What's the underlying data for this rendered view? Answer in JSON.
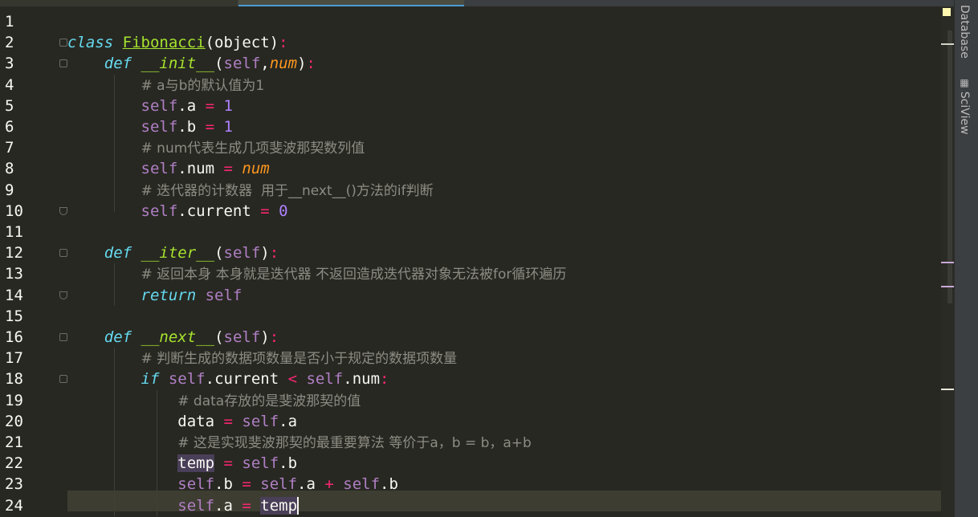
{
  "editor": {
    "line_numbers": [
      "1",
      "2",
      "3",
      "4",
      "5",
      "6",
      "7",
      "8",
      "9",
      "10",
      "11",
      "12",
      "13",
      "14",
      "15",
      "16",
      "17",
      "18",
      "19",
      "20",
      "21",
      "22",
      "23",
      "24"
    ],
    "lines": [
      [],
      [
        [
          "kw",
          "class"
        ],
        [
          "plain",
          " "
        ],
        [
          "cls",
          "Fibonacci"
        ],
        [
          "plain",
          "(object)"
        ],
        [
          "op",
          ":"
        ]
      ],
      [
        [
          "plain",
          "    "
        ],
        [
          "kw",
          "def"
        ],
        [
          "plain",
          " "
        ],
        [
          "fn",
          "__init__"
        ],
        [
          "plain",
          "("
        ],
        [
          "self",
          "self"
        ],
        [
          "plain",
          ","
        ],
        [
          "param",
          "num"
        ],
        [
          "plain",
          ")"
        ],
        [
          "op",
          ":"
        ]
      ],
      [
        [
          "plain",
          "        "
        ],
        [
          "cm",
          "# a与b的默认值为1"
        ]
      ],
      [
        [
          "plain",
          "        "
        ],
        [
          "self",
          "self"
        ],
        [
          "plain",
          ".a "
        ],
        [
          "op",
          "="
        ],
        [
          "plain",
          " "
        ],
        [
          "num",
          "1"
        ]
      ],
      [
        [
          "plain",
          "        "
        ],
        [
          "self",
          "self"
        ],
        [
          "plain",
          ".b "
        ],
        [
          "op",
          "="
        ],
        [
          "plain",
          " "
        ],
        [
          "num",
          "1"
        ]
      ],
      [
        [
          "plain",
          "        "
        ],
        [
          "cm",
          "# num代表生成几项斐波那契数列值"
        ]
      ],
      [
        [
          "plain",
          "        "
        ],
        [
          "self",
          "self"
        ],
        [
          "plain",
          ".num "
        ],
        [
          "op",
          "="
        ],
        [
          "plain",
          " "
        ],
        [
          "param",
          "num"
        ]
      ],
      [
        [
          "plain",
          "        "
        ],
        [
          "cm",
          "# 迭代器的计数器  用于__next__()方法的if判断"
        ]
      ],
      [
        [
          "plain",
          "        "
        ],
        [
          "self",
          "self"
        ],
        [
          "plain",
          ".current "
        ],
        [
          "op",
          "="
        ],
        [
          "plain",
          " "
        ],
        [
          "num",
          "0"
        ]
      ],
      [],
      [
        [
          "plain",
          "    "
        ],
        [
          "kw",
          "def"
        ],
        [
          "plain",
          " "
        ],
        [
          "fn",
          "__iter__"
        ],
        [
          "plain",
          "("
        ],
        [
          "self",
          "self"
        ],
        [
          "plain",
          ")"
        ],
        [
          "op",
          ":"
        ]
      ],
      [
        [
          "plain",
          "        "
        ],
        [
          "cm",
          "# 返回本身 本身就是迭代器 不返回造成迭代器对象无法被for循环遍历"
        ]
      ],
      [
        [
          "plain",
          "        "
        ],
        [
          "kw",
          "return"
        ],
        [
          "plain",
          " "
        ],
        [
          "self",
          "self"
        ]
      ],
      [],
      [
        [
          "plain",
          "    "
        ],
        [
          "kw",
          "def"
        ],
        [
          "plain",
          " "
        ],
        [
          "fn",
          "__next__"
        ],
        [
          "plain",
          "("
        ],
        [
          "self",
          "self"
        ],
        [
          "plain",
          ")"
        ],
        [
          "op",
          ":"
        ]
      ],
      [
        [
          "plain",
          "        "
        ],
        [
          "cm",
          "# 判断生成的数据项数量是否小于规定的数据项数量"
        ]
      ],
      [
        [
          "plain",
          "        "
        ],
        [
          "kw",
          "if"
        ],
        [
          "plain",
          " "
        ],
        [
          "self",
          "self"
        ],
        [
          "plain",
          ".current "
        ],
        [
          "op",
          "<"
        ],
        [
          "plain",
          " "
        ],
        [
          "self",
          "self"
        ],
        [
          "plain",
          ".num"
        ],
        [
          "op",
          ":"
        ]
      ],
      [
        [
          "plain",
          "            "
        ],
        [
          "cm",
          "# data存放的是斐波那契的值"
        ]
      ],
      [
        [
          "plain",
          "            data "
        ],
        [
          "op",
          "="
        ],
        [
          "plain",
          " "
        ],
        [
          "self",
          "self"
        ],
        [
          "plain",
          ".a"
        ]
      ],
      [
        [
          "plain",
          "            "
        ],
        [
          "cm",
          "# 这是实现斐波那契的最重要算法 等价于a，b = b，a+b"
        ]
      ],
      [
        [
          "plain",
          "            "
        ],
        [
          "hl",
          "temp"
        ],
        [
          "plain",
          " "
        ],
        [
          "op",
          "="
        ],
        [
          "plain",
          " "
        ],
        [
          "self",
          "self"
        ],
        [
          "plain",
          ".b"
        ]
      ],
      [
        [
          "plain",
          "            "
        ],
        [
          "self",
          "self"
        ],
        [
          "plain",
          ".b "
        ],
        [
          "op",
          "="
        ],
        [
          "plain",
          " "
        ],
        [
          "self",
          "self"
        ],
        [
          "plain",
          ".a "
        ],
        [
          "op",
          "+"
        ],
        [
          "plain",
          " "
        ],
        [
          "self",
          "self"
        ],
        [
          "plain",
          ".b"
        ]
      ],
      [
        [
          "plain",
          "            "
        ],
        [
          "self",
          "self"
        ],
        [
          "plain",
          ".a "
        ],
        [
          "op",
          "="
        ],
        [
          "plain",
          " "
        ],
        [
          "hl",
          "temp"
        ],
        [
          "caret",
          ""
        ]
      ]
    ]
  },
  "right_panel": {
    "tabs": [
      "Database",
      "SciView"
    ]
  },
  "colors": {
    "background": "#272822",
    "keyword": "#66d9ef",
    "function": "#a6e22e",
    "operator": "#f92672",
    "number": "#ae81ff",
    "comment": "#8c8c83"
  }
}
